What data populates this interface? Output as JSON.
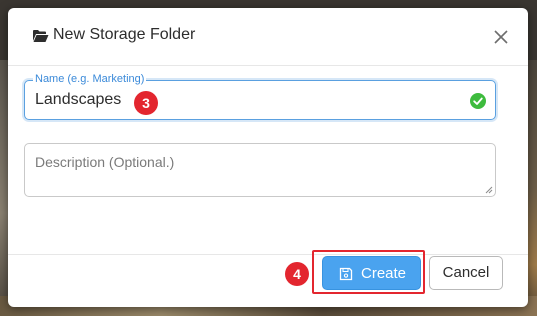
{
  "dialog": {
    "title": "New Storage Folder",
    "name_field": {
      "label": "Name (e.g. Marketing)",
      "value": "Landscapes",
      "valid": true
    },
    "description_field": {
      "placeholder": "Description (Optional.)",
      "value": ""
    },
    "buttons": {
      "create_label": "Create",
      "cancel_label": "Cancel"
    }
  },
  "annotations": {
    "step_name": "3",
    "step_create": "4"
  },
  "icons": {
    "title": "folder-open-icon",
    "close": "close-icon",
    "valid": "check-circle-icon",
    "create": "save-icon"
  },
  "colors": {
    "primary": "#4aa3ef",
    "label": "#3b8ad9",
    "valid": "#3dbb3d",
    "annotation": "#e3262f"
  }
}
